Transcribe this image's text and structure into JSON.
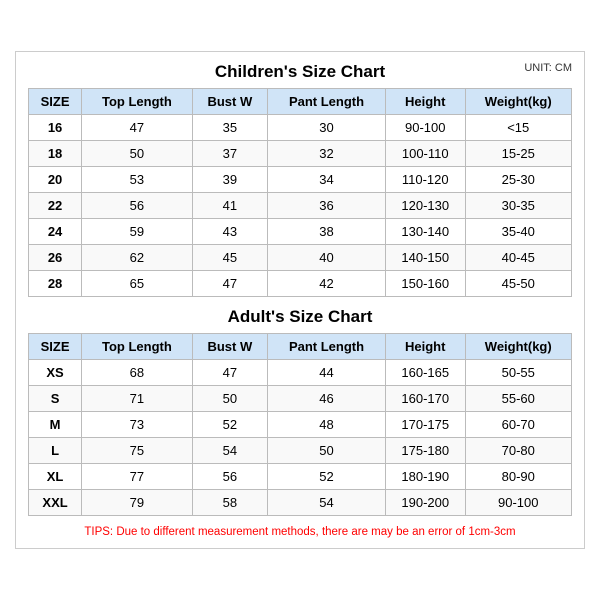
{
  "unit": "UNIT: CM",
  "children": {
    "title": "Children's Size Chart",
    "headers": [
      "SIZE",
      "Top Length",
      "Bust W",
      "Pant Length",
      "Height",
      "Weight(kg)"
    ],
    "rows": [
      [
        "16",
        "47",
        "35",
        "30",
        "90-100",
        "<15"
      ],
      [
        "18",
        "50",
        "37",
        "32",
        "100-110",
        "15-25"
      ],
      [
        "20",
        "53",
        "39",
        "34",
        "110-120",
        "25-30"
      ],
      [
        "22",
        "56",
        "41",
        "36",
        "120-130",
        "30-35"
      ],
      [
        "24",
        "59",
        "43",
        "38",
        "130-140",
        "35-40"
      ],
      [
        "26",
        "62",
        "45",
        "40",
        "140-150",
        "40-45"
      ],
      [
        "28",
        "65",
        "47",
        "42",
        "150-160",
        "45-50"
      ]
    ]
  },
  "adults": {
    "title": "Adult's Size Chart",
    "headers": [
      "SIZE",
      "Top Length",
      "Bust W",
      "Pant Length",
      "Height",
      "Weight(kg)"
    ],
    "rows": [
      [
        "XS",
        "68",
        "47",
        "44",
        "160-165",
        "50-55"
      ],
      [
        "S",
        "71",
        "50",
        "46",
        "160-170",
        "55-60"
      ],
      [
        "M",
        "73",
        "52",
        "48",
        "170-175",
        "60-70"
      ],
      [
        "L",
        "75",
        "54",
        "50",
        "175-180",
        "70-80"
      ],
      [
        "XL",
        "77",
        "56",
        "52",
        "180-190",
        "80-90"
      ],
      [
        "XXL",
        "79",
        "58",
        "54",
        "190-200",
        "90-100"
      ]
    ]
  },
  "tips": "TIPS: Due to different measurement methods, there are may be an error of 1cm-3cm"
}
